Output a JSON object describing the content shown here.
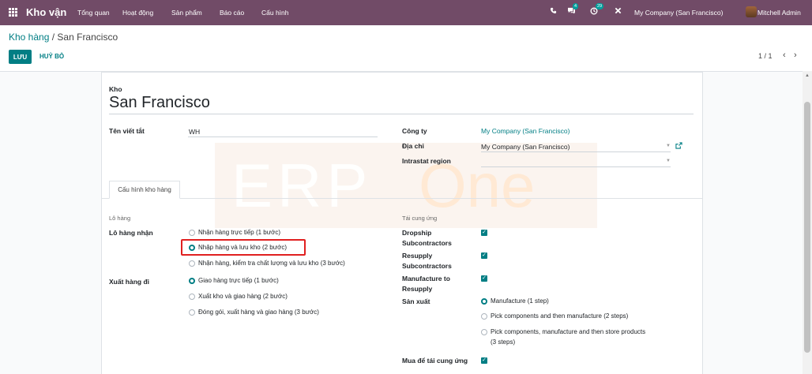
{
  "topnav": {
    "app_name": "Kho vận",
    "menu": [
      "Tổng quan",
      "Hoạt động",
      "Sản phẩm",
      "Báo cáo",
      "Cấu hình"
    ],
    "messages_badge": "4",
    "activity_badge": "29",
    "company": "My Company (San Francisco)",
    "user": "Mitchell Admin",
    "brand_color": "#714B67"
  },
  "breadcrumb": {
    "parent": "Kho hàng",
    "sep": "/",
    "current": "San Francisco"
  },
  "actions": {
    "save": "LƯU",
    "discard": "HUỶ BỎ"
  },
  "pager": {
    "value": "1 / 1"
  },
  "form": {
    "name_label": "Kho",
    "name": "San Francisco",
    "short_name_label": "Tên viết tắt",
    "short_name": "WH",
    "company_label": "Công ty",
    "company": "My Company (San Francisco)",
    "address_label": "Địa chỉ",
    "address": "My Company (San Francisco)",
    "intrastat_label": "Intrastat region",
    "intrastat": ""
  },
  "tab": {
    "label": "Cấu hình kho hàng"
  },
  "shipments": {
    "section": "Lô hàng",
    "incoming_label": "Lô hàng nhận",
    "incoming_options": [
      {
        "label": "Nhận hàng trực tiếp (1 bước)",
        "selected": false
      },
      {
        "label": "Nhập hàng và lưu kho (2 bước)",
        "selected": true
      },
      {
        "label": "Nhận hàng, kiểm tra chất lượng và lưu kho (3 bước)",
        "selected": false
      }
    ],
    "outgoing_label": "Xuất hàng đi",
    "outgoing_options": [
      {
        "label": "Giao hàng trực tiếp (1 bước)",
        "selected": true
      },
      {
        "label": "Xuất kho và giao hàng (2 bước)",
        "selected": false
      },
      {
        "label": "Đóng gói, xuất hàng và giao hàng (3 bước)",
        "selected": false
      }
    ]
  },
  "resupply": {
    "section": "Tái cung ứng",
    "dropship_line1": "Dropship",
    "dropship_line2": "Subcontractors",
    "dropship_checked": true,
    "resupply_sub_line1": "Resupply",
    "resupply_sub_line2": "Subcontractors",
    "resupply_sub_checked": true,
    "mto_line1": "Manufacture to",
    "mto_line2": "Resupply",
    "mto_checked": true,
    "manufacture_label": "Sản xuất",
    "manufacture_options": [
      {
        "label": "Manufacture (1 step)",
        "selected": true
      },
      {
        "label": "Pick components and then manufacture (2 steps)",
        "selected": false
      },
      {
        "label_line1": "Pick components, manufacture and then store products",
        "label_line2": "(3 steps)",
        "selected": false
      }
    ],
    "buy_label": "Mua để tái cung ứng",
    "buy_checked": true
  },
  "watermark": {
    "part1": "ERP",
    "part2": "One"
  }
}
